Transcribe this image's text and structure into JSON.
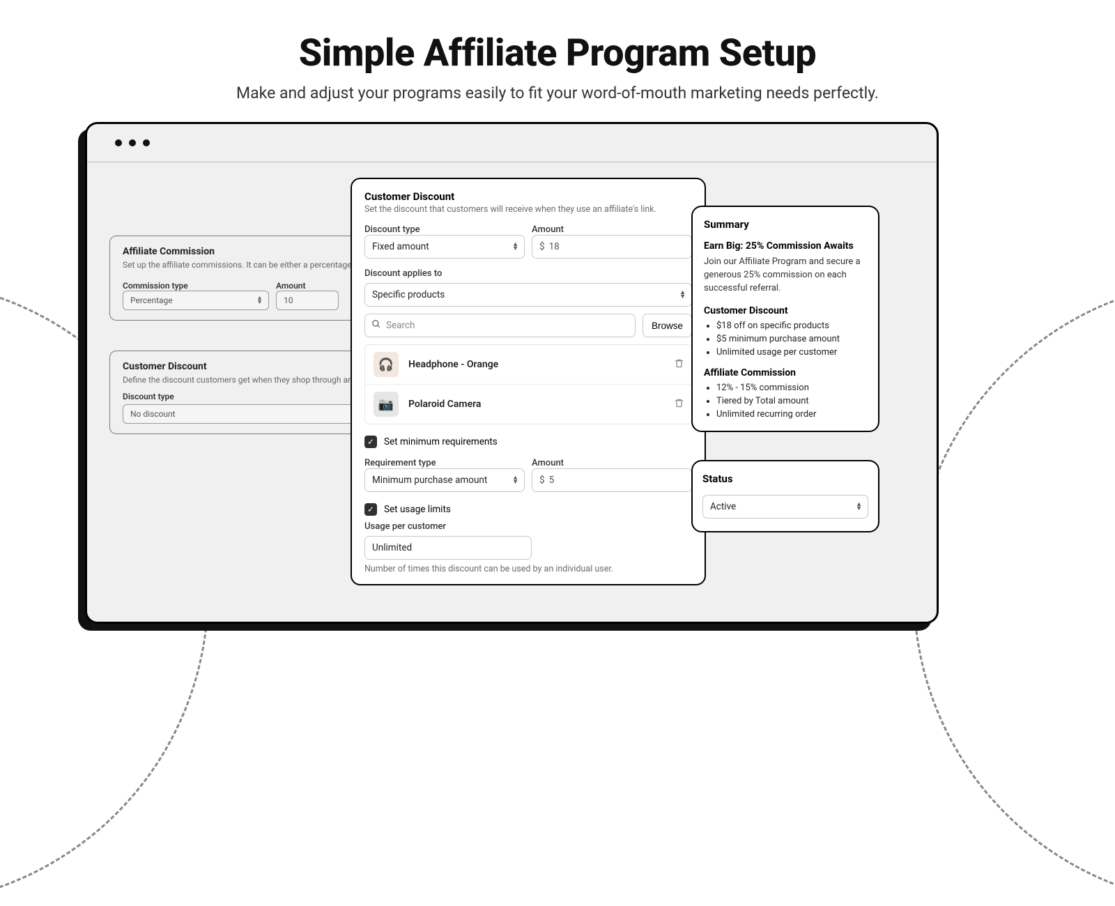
{
  "hero": {
    "title": "Simple Affiliate Program Setup",
    "subtitle": "Make and adjust your programs easily to fit your word-of-mouth marketing needs perfectly."
  },
  "bg_commission": {
    "title": "Affiliate Commission",
    "sub": "Set up the affiliate commissions. It can be either a percentage of the sale or",
    "type_label": "Commission type",
    "type_value": "Percentage",
    "amount_label": "Amount",
    "amount_value": "10"
  },
  "bg_discount": {
    "title": "Customer Discount",
    "sub": "Define the discount customers get when they shop through an affiliate's link.",
    "type_label": "Discount type",
    "type_value": "No discount"
  },
  "popover": {
    "title": "Customer Discount",
    "sub": "Set the discount that customers will receive when they use an affiliate's link.",
    "discount_type_label": "Discount type",
    "discount_type_value": "Fixed amount",
    "amount_label": "Amount",
    "amount_currency": "$",
    "amount_value": "18",
    "applies_to_label": "Discount applies to",
    "applies_to_value": "Specific products",
    "search_placeholder": "Search",
    "browse_label": "Browse",
    "products": [
      {
        "name": "Headphone - Orange"
      },
      {
        "name": "Polaroid Camera"
      }
    ],
    "min_req_label": "Set minimum requirements",
    "req_type_label": "Requirement type",
    "req_type_value": "Minimum purchase amount",
    "req_amount_label": "Amount",
    "req_amount_currency": "$",
    "req_amount_value": "5",
    "usage_limits_label": "Set usage limits",
    "usage_per_label": "Usage per customer",
    "usage_per_value": "Unlimited",
    "usage_hint": "Number of times this discount can be used by an individual user."
  },
  "summary": {
    "title": "Summary",
    "headline": "Earn Big: 25% Commission Awaits",
    "desc": "Join our Affiliate Program and secure a generous 25% commission on each successful referral.",
    "cd_label": "Customer Discount",
    "cd_items": [
      "$18 off on specific products",
      "$5 minimum purchase amount",
      "Unlimited usage per customer"
    ],
    "ac_label": "Affiliate Commission",
    "ac_items": [
      "12% - 15% commission",
      "Tiered by Total amount",
      "Unlimited recurring order"
    ]
  },
  "status": {
    "title": "Status",
    "value": "Active"
  }
}
